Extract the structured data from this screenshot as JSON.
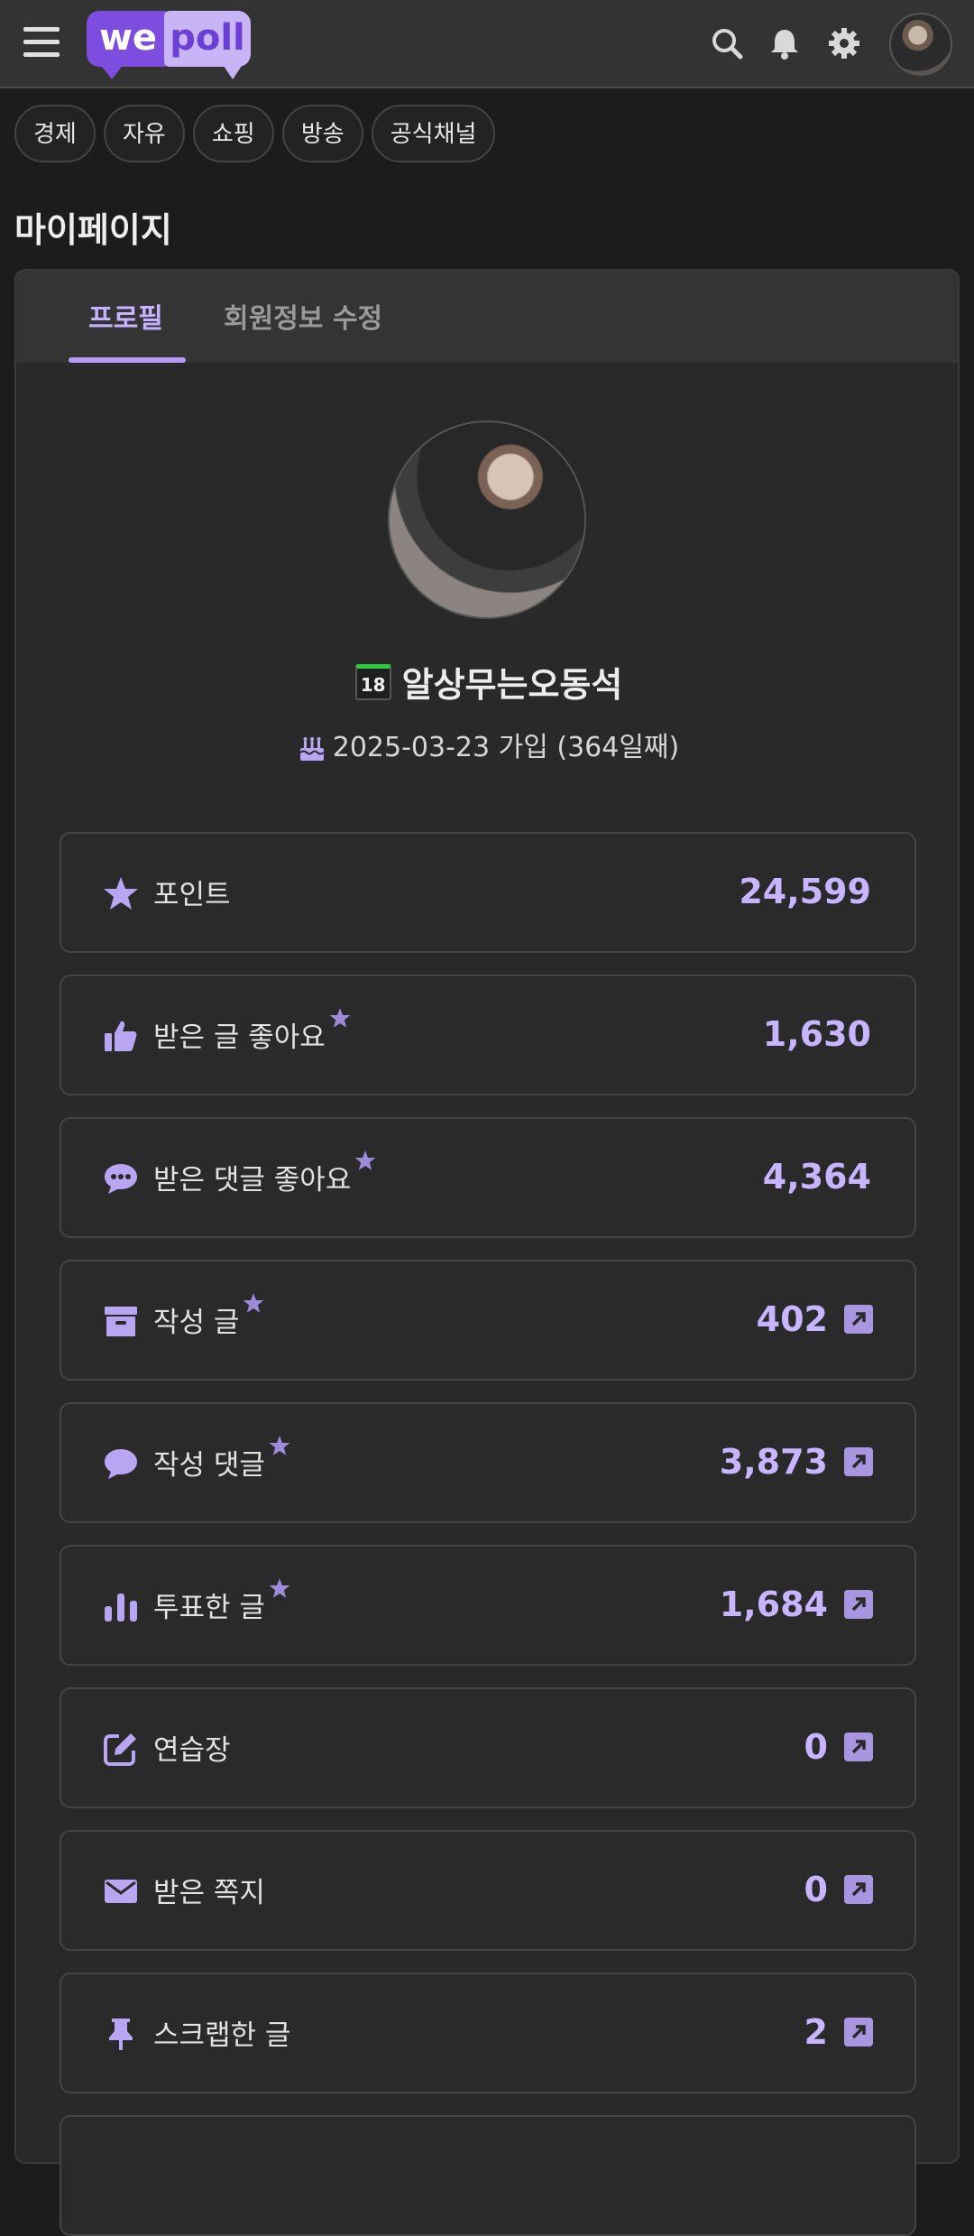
{
  "header": {
    "logo_we": "we",
    "logo_poll": "poll"
  },
  "categories": [
    "경제",
    "자유",
    "쇼핑",
    "방송",
    "공식채널"
  ],
  "page_title": "마이페이지",
  "tabs": [
    {
      "label": "프로필",
      "active": true
    },
    {
      "label": "회원정보 수정",
      "active": false
    }
  ],
  "profile": {
    "level_badge": "18",
    "nickname": "알상무는오동석",
    "join_text": "2025-03-23 가입 (364일째)"
  },
  "stats": [
    {
      "icon": "star-icon",
      "label": "포인트",
      "value": "24,599",
      "starred": false,
      "link": false
    },
    {
      "icon": "thumbs-up-icon",
      "label": "받은 글 좋아요",
      "value": "1,630",
      "starred": true,
      "link": false
    },
    {
      "icon": "comment-dots-icon",
      "label": "받은 댓글 좋아요",
      "value": "4,364",
      "starred": true,
      "link": false
    },
    {
      "icon": "archive-icon",
      "label": "작성 글",
      "value": "402",
      "starred": true,
      "link": true
    },
    {
      "icon": "comment-icon",
      "label": "작성 댓글",
      "value": "3,873",
      "starred": true,
      "link": true
    },
    {
      "icon": "bar-chart-icon",
      "label": "투표한 글",
      "value": "1,684",
      "starred": true,
      "link": true
    },
    {
      "icon": "edit-icon",
      "label": "연습장",
      "value": "0",
      "starred": false,
      "link": true
    },
    {
      "icon": "envelope-icon",
      "label": "받은 쪽지",
      "value": "0",
      "starred": false,
      "link": true
    },
    {
      "icon": "thumbtack-icon",
      "label": "스크랩한 글",
      "value": "2",
      "starred": false,
      "link": true
    }
  ],
  "colors": {
    "accent": "#c8b5ff",
    "brand_purple": "#7c4dde",
    "brand_light": "#c9b5f5",
    "level_badge_bar": "#2ecc40"
  }
}
